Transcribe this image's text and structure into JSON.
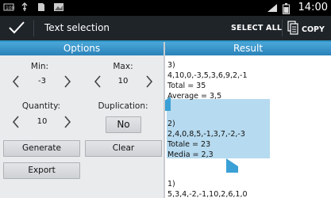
{
  "statusbar": {
    "left_icons": [
      "usb-icon",
      "sd-card-icon",
      "image-icon",
      "debug-icon"
    ],
    "right_icons": [
      "signal-icon",
      "battery-icon"
    ],
    "time": "14:00"
  },
  "actionbar": {
    "title": "Text selection",
    "select_all": "SELECT ALL",
    "copy": "COPY"
  },
  "tabs": {
    "options": "Options",
    "result": "Result"
  },
  "options": {
    "min_label": "Min:",
    "min_value": "-3",
    "max_label": "Max:",
    "max_value": "10",
    "quantity_label": "Quantity:",
    "quantity_value": "10",
    "duplication_label": "Duplication:",
    "duplication_value": "No",
    "generate": "Generate",
    "clear": "Clear",
    "export": "Export"
  },
  "result": {
    "lines": [
      "3)",
      "4,10,0,-3,5,3,6,9,2,-1",
      "Total = 35",
      "Average = 3,5",
      "",
      "2)",
      "2,4,0,8,5,-1,3,7,-2,-3",
      "Totale = 23",
      "Media = 2,3",
      "",
      "1)",
      "5,3,4,-2,-1,10,2,6,1,0"
    ]
  },
  "colors": {
    "accent": "#2f97c5",
    "actionbar": "#1f2429",
    "selection": "#a9d3ec"
  }
}
